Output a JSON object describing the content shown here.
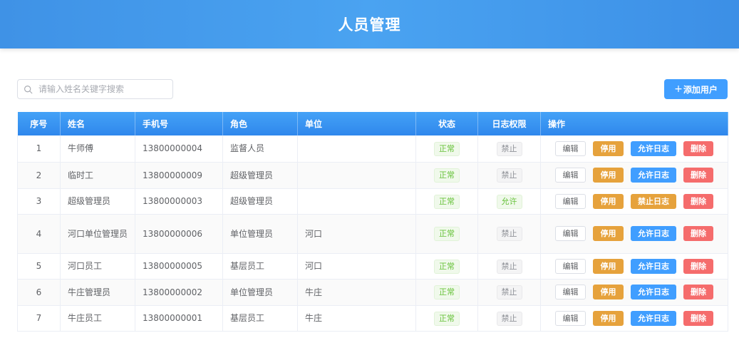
{
  "header": {
    "title": "人员管理"
  },
  "search": {
    "placeholder": "请输入姓名关键字搜索",
    "value": ""
  },
  "toolbar": {
    "add_plus": "+",
    "add_label": "添加用户"
  },
  "table": {
    "columns": [
      "序号",
      "姓名",
      "手机号",
      "角色",
      "单位",
      "状态",
      "日志权限",
      "操作"
    ],
    "rows": [
      {
        "index": "1",
        "name": "牛师傅",
        "phone": "13800000004",
        "role": "监督人员",
        "unit": "",
        "status": "正常",
        "log": "禁止",
        "log_allowed": false,
        "actions": [
          "编辑",
          "停用",
          "允许日志",
          "删除"
        ]
      },
      {
        "index": "2",
        "name": "临时工",
        "phone": "13800000009",
        "role": "超级管理员",
        "unit": "",
        "status": "正常",
        "log": "禁止",
        "log_allowed": false,
        "actions": [
          "编辑",
          "停用",
          "允许日志",
          "删除"
        ]
      },
      {
        "index": "3",
        "name": "超级管理员",
        "phone": "13800000003",
        "role": "超级管理员",
        "unit": "",
        "status": "正常",
        "log": "允许",
        "log_allowed": true,
        "actions": [
          "编辑",
          "停用",
          "禁止日志",
          "删除"
        ]
      },
      {
        "index": "4",
        "name": "河口单位管理员",
        "phone": "13800000006",
        "role": "单位管理员",
        "unit": "河口",
        "status": "正常",
        "log": "禁止",
        "log_allowed": false,
        "actions": [
          "编辑",
          "停用",
          "允许日志",
          "删除"
        ]
      },
      {
        "index": "5",
        "name": "河口员工",
        "phone": "13800000005",
        "role": "基层员工",
        "unit": "河口",
        "status": "正常",
        "log": "禁止",
        "log_allowed": false,
        "actions": [
          "编辑",
          "停用",
          "允许日志",
          "删除"
        ]
      },
      {
        "index": "6",
        "name": "牛庄管理员",
        "phone": "13800000002",
        "role": "单位管理员",
        "unit": "牛庄",
        "status": "正常",
        "log": "禁止",
        "log_allowed": false,
        "actions": [
          "编辑",
          "停用",
          "允许日志",
          "删除"
        ]
      },
      {
        "index": "7",
        "name": "牛庄员工",
        "phone": "13800000001",
        "role": "基层员工",
        "unit": "牛庄",
        "status": "正常",
        "log": "禁止",
        "log_allowed": false,
        "actions": [
          "编辑",
          "停用",
          "允许日志",
          "删除"
        ]
      }
    ]
  },
  "colors": {
    "primary": "#409eff",
    "warning": "#e6a23c",
    "danger": "#f56c6c",
    "success": "#67c23a",
    "info": "#909399"
  },
  "icons": {
    "search": "search-icon",
    "add": "plus-icon"
  }
}
